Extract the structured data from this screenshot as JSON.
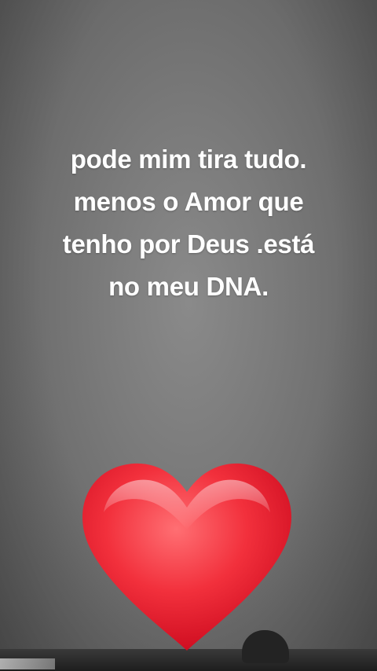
{
  "quote": {
    "lines": [
      "pode mim tira tudo.",
      "menos o Amor que",
      "tenho por Deus .está",
      "no meu DNA."
    ]
  },
  "colors": {
    "background": "#7a7a7a",
    "text": "#ffffff",
    "heart": "#e8182a"
  },
  "icons": {
    "heart": "red-heart-emoji"
  }
}
